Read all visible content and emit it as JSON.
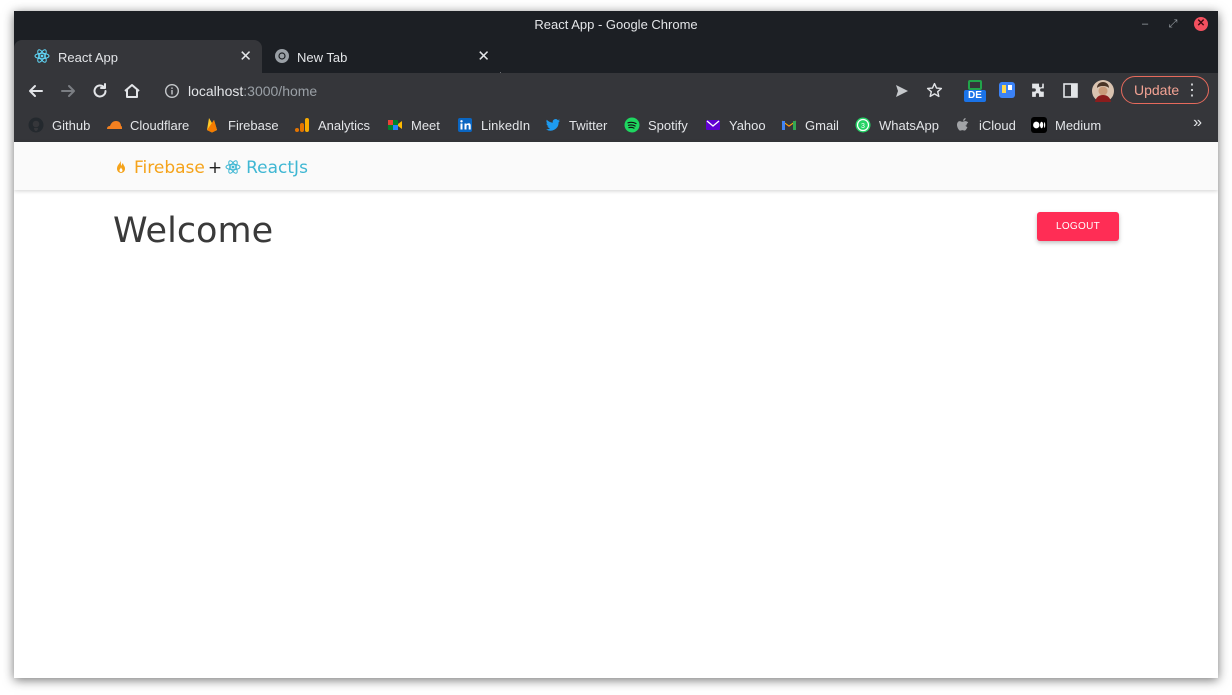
{
  "window": {
    "title": "React App - Google Chrome"
  },
  "tabs": [
    {
      "label": "React App",
      "icon": "react-icon",
      "active": true
    },
    {
      "label": "New Tab",
      "icon": "chrome-icon",
      "active": false
    }
  ],
  "omnibox": {
    "host": "localhost",
    "path": ":3000/home"
  },
  "toolbar": {
    "update_label": "Update"
  },
  "bookmarks": [
    {
      "label": "Github",
      "icon": "github-icon"
    },
    {
      "label": "Cloudflare",
      "icon": "cloudflare-icon"
    },
    {
      "label": "Firebase",
      "icon": "firebase-icon"
    },
    {
      "label": "Analytics",
      "icon": "analytics-icon"
    },
    {
      "label": "Meet",
      "icon": "meet-icon"
    },
    {
      "label": "LinkedIn",
      "icon": "linkedin-icon"
    },
    {
      "label": "Twitter",
      "icon": "twitter-icon"
    },
    {
      "label": "Spotify",
      "icon": "spotify-icon"
    },
    {
      "label": "Yahoo",
      "icon": "yahoo-icon"
    },
    {
      "label": "Gmail",
      "icon": "gmail-icon"
    },
    {
      "label": "WhatsApp",
      "icon": "whatsapp-icon"
    },
    {
      "label": "iCloud",
      "icon": "apple-icon"
    },
    {
      "label": "Medium",
      "icon": "medium-icon"
    }
  ],
  "app": {
    "brand_firebase": "Firebase",
    "brand_plus": "+",
    "brand_react": "ReactJs",
    "heading": "Welcome",
    "logout_label": "LOGOUT"
  },
  "colors": {
    "firebase": "#f5a31a",
    "react": "#3fb7d3",
    "logout": "#ff2d55",
    "chrome_dark": "#35363a"
  }
}
